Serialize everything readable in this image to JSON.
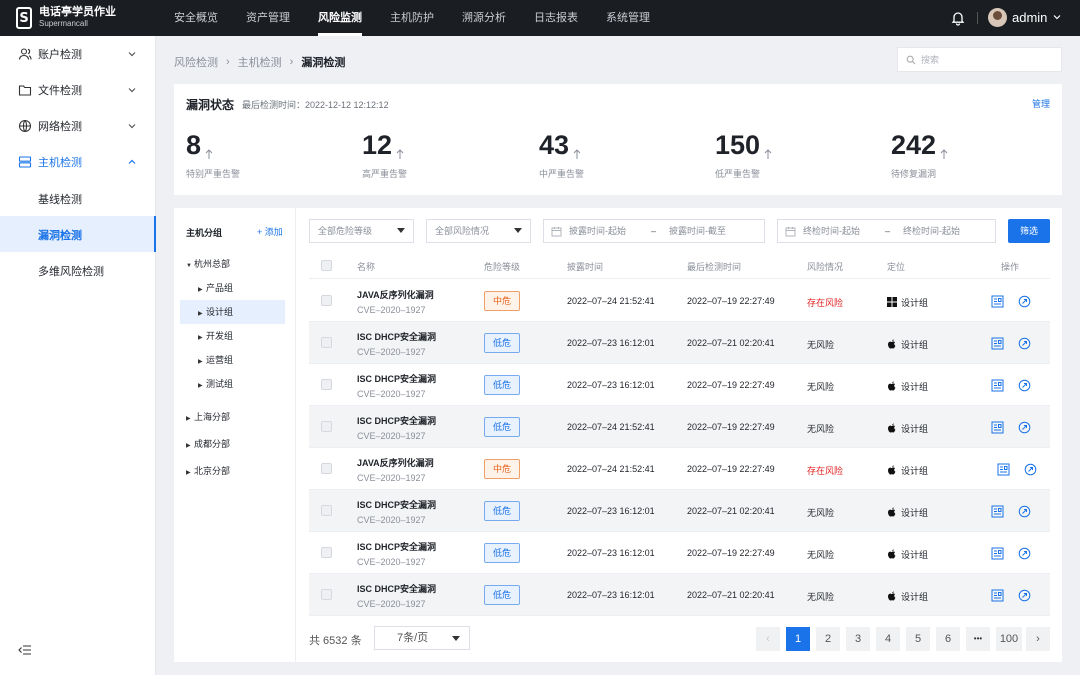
{
  "brand": {
    "name": "电话亭学员作业",
    "sub": "Supermancall",
    "logo_letter": "S"
  },
  "topnav": [
    "安全概览",
    "资产管理",
    "风险监测",
    "主机防护",
    "溯源分析",
    "日志报表",
    "系统管理"
  ],
  "user": {
    "name": "admin"
  },
  "sidebar": {
    "items": [
      {
        "label": "账户检测"
      },
      {
        "label": "文件检测"
      },
      {
        "label": "网络检测"
      },
      {
        "label": "主机检测"
      }
    ],
    "sub": [
      {
        "label": "基线检测"
      },
      {
        "label": "漏洞检测"
      },
      {
        "label": "多维风险检测"
      }
    ]
  },
  "breadcrumb": [
    "风险检测",
    "主机检测",
    "漏洞检测"
  ],
  "search": {
    "placeholder": "搜索"
  },
  "status": {
    "title": "漏洞状态",
    "time": "最后检测时间：2022-12-12 12:12:12",
    "manage": "管理",
    "stats": [
      {
        "value": "8",
        "label": "特别严重告警"
      },
      {
        "value": "12",
        "label": "高严重告警"
      },
      {
        "value": "43",
        "label": "中严重告警"
      },
      {
        "value": "150",
        "label": "低严重告警"
      },
      {
        "value": "242",
        "label": "待修复漏洞"
      }
    ]
  },
  "tree": {
    "title": "主机分组",
    "add": "+ 添加",
    "nodes": [
      {
        "label": "杭州总部"
      },
      {
        "label": "产品组"
      },
      {
        "label": "设计组"
      },
      {
        "label": "开发组"
      },
      {
        "label": "运营组"
      },
      {
        "label": "测试组"
      },
      {
        "label": "上海分部"
      },
      {
        "label": "成都分部"
      },
      {
        "label": "北京分部"
      }
    ]
  },
  "filters": {
    "level": "全部危险等级",
    "risk": "全部风险情况",
    "expose_start": "披露时间-起始",
    "expose_end": "披露时间-截至",
    "check_start": "终检时间-起始",
    "check_end": "终检时间-起始",
    "button": "筛选"
  },
  "table": {
    "headers": [
      "名称",
      "危险等级",
      "披露时间",
      "最后检测时间",
      "风险情况",
      "定位",
      "操作"
    ],
    "rows": [
      {
        "name": "JAVA反序列化漏洞",
        "cve": "CVE–2020–1927",
        "level": "中危",
        "disclosed": "2022–07–24 21:52:41",
        "checked": "2022–07–19 22:27:49",
        "risk": "存在风险",
        "os": "windows",
        "loc": "设计组"
      },
      {
        "name": "ISC DHCP安全漏洞",
        "cve": "CVE–2020–1927",
        "level": "低危",
        "disclosed": "2022–07–23 16:12:01",
        "checked": "2022–07–21 02:20:41",
        "risk": "无风险",
        "os": "apple",
        "loc": "设计组"
      },
      {
        "name": "ISC DHCP安全漏洞",
        "cve": "CVE–2020–1927",
        "level": "低危",
        "disclosed": "2022–07–23 16:12:01",
        "checked": "2022–07–19 22:27:49",
        "risk": "无风险",
        "os": "apple",
        "loc": "设计组"
      },
      {
        "name": "ISC DHCP安全漏洞",
        "cve": "CVE–2020–1927",
        "level": "低危",
        "disclosed": "2022–07–24 21:52:41",
        "checked": "2022–07–19 22:27:49",
        "risk": "无风险",
        "os": "apple",
        "loc": "设计组"
      },
      {
        "name": "JAVA反序列化漏洞",
        "cve": "CVE–2020–1927",
        "level": "中危",
        "disclosed": "2022–07–24 21:52:41",
        "checked": "2022–07–19 22:27:49",
        "risk": "存在风险",
        "os": "apple",
        "loc": "设计组"
      },
      {
        "name": "ISC DHCP安全漏洞",
        "cve": "CVE–2020–1927",
        "level": "低危",
        "disclosed": "2022–07–23 16:12:01",
        "checked": "2022–07–21 02:20:41",
        "risk": "无风险",
        "os": "apple",
        "loc": "设计组"
      },
      {
        "name": "ISC DHCP安全漏洞",
        "cve": "CVE–2020–1927",
        "level": "低危",
        "disclosed": "2022–07–23 16:12:01",
        "checked": "2022–07–19 22:27:49",
        "risk": "无风险",
        "os": "apple",
        "loc": "设计组"
      },
      {
        "name": "ISC DHCP安全漏洞",
        "cve": "CVE–2020–1927",
        "level": "低危",
        "disclosed": "2022–07–23 16:12:01",
        "checked": "2022–07–21 02:20:41",
        "risk": "无风险",
        "os": "apple",
        "loc": "设计组"
      }
    ]
  },
  "pagination": {
    "total": "共 6532 条",
    "page_size": "7条/页",
    "pages": [
      "1",
      "2",
      "3",
      "4",
      "5",
      "6"
    ],
    "ellipsis": "•••",
    "last": "100",
    "current": "1"
  },
  "colors": {
    "accent": "#1a73e8",
    "danger": "#e02020",
    "warning": "#e8631a",
    "topbar": "#1a1d22"
  }
}
